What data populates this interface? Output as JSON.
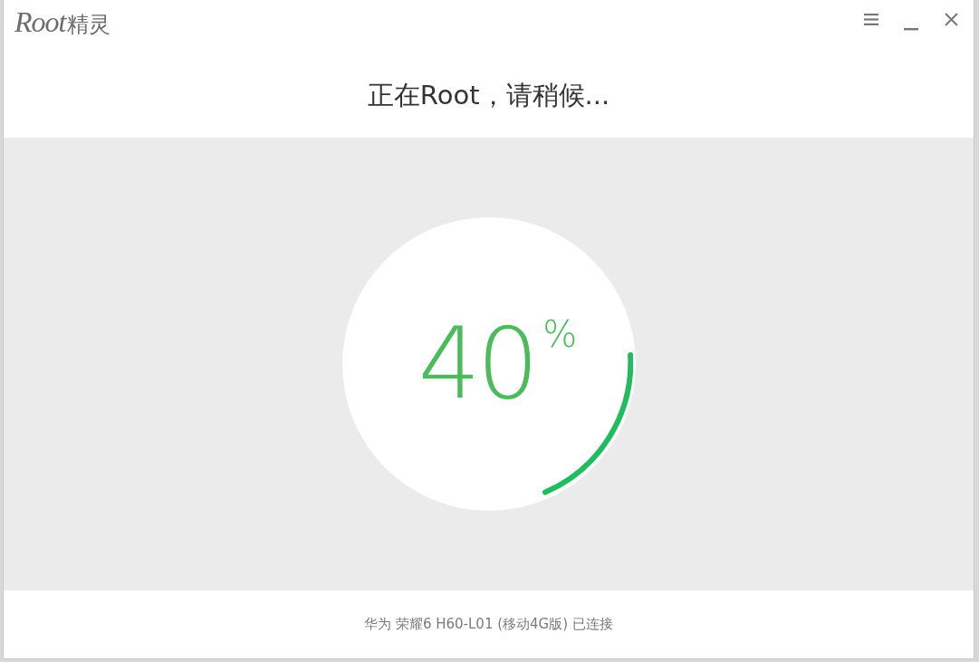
{
  "app": {
    "logo_latin": "Root",
    "logo_cjk": "精灵"
  },
  "header": {
    "title": "正在Root，请稍候..."
  },
  "progress": {
    "value": "40",
    "unit": "%"
  },
  "status_bar": {
    "text": "华为 荣耀6 H60-L01 (移动4G版) 已连接"
  }
}
